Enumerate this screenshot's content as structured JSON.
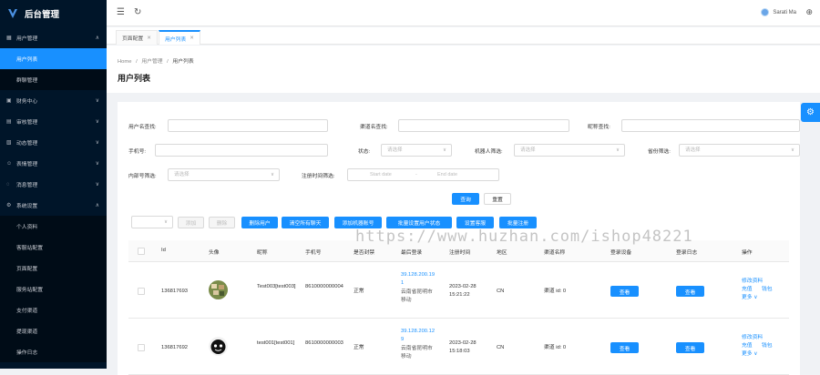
{
  "app": {
    "title": "后台管理"
  },
  "sidebar": {
    "groups": [
      {
        "label": "用户管理",
        "icon": "table-icon",
        "expanded": true,
        "items": [
          {
            "label": "用户列表",
            "active": true
          },
          {
            "label": "群聊管理",
            "active": false
          }
        ]
      },
      {
        "label": "财务中心",
        "icon": "wallet-icon"
      },
      {
        "label": "审核管理",
        "icon": "audit-icon"
      },
      {
        "label": "动态管理",
        "icon": "image-icon"
      },
      {
        "label": "表情管理",
        "icon": "smile-icon"
      },
      {
        "label": "消息管理",
        "icon": "message-icon"
      },
      {
        "label": "系统设置",
        "icon": "gear-icon",
        "expanded": true,
        "items": [
          {
            "label": "个人资料"
          },
          {
            "label": "客服站配置"
          },
          {
            "label": "页面配置"
          },
          {
            "label": "服务站配置"
          },
          {
            "label": "支付渠道"
          },
          {
            "label": "提现渠道"
          },
          {
            "label": "操作日志"
          }
        ]
      }
    ]
  },
  "topbar": {
    "user_name": "Sarati Ma"
  },
  "tabs": [
    {
      "label": "页面配置",
      "active": false
    },
    {
      "label": "用户列表",
      "active": true
    }
  ],
  "breadcrumb": {
    "home": "Home",
    "sep": "/",
    "section": "用户管理",
    "current": "用户列表"
  },
  "page_title": "用户列表",
  "filters": {
    "username_label": "用户名查找:",
    "channel_label": "渠道名查找:",
    "nickname_label": "昵称查找:",
    "phone_label": "手机号:",
    "status_label": "状态:",
    "status_placeholder": "请选择",
    "robot_label": "机器人筛选:",
    "robot_placeholder": "请选择",
    "region_label": "省份筛选:",
    "region_placeholder": "请选择",
    "internal_label": "内部号筛选:",
    "internal_placeholder": "请选择",
    "regtime_label": "注册时间筛选:",
    "start_date": "Start date",
    "date_sep": "-",
    "end_date": "End date",
    "search_button": "查询",
    "reset_button": "重置"
  },
  "actions": {
    "add": "添加",
    "delete": "删除",
    "delete_user": "删除用户",
    "clear_chat": "清空所有聊天",
    "add_robot": "添加机器账号",
    "batch_set": "批量设置用户状态",
    "set_robot": "设置客服",
    "batch_export": "批量注册"
  },
  "table": {
    "columns": [
      "Id",
      "头像",
      "昵称",
      "手机号",
      "是否封禁",
      "最后登录",
      "注册时间",
      "地区",
      "渠道名称",
      "登录设备",
      "登录日志",
      "操作"
    ],
    "rows": [
      {
        "id": "136817693",
        "nickname": "Test003[test003]",
        "phone": "8610000000004",
        "banned": "正常",
        "last_ip": "39.128.200.191",
        "last_loc": "云南省昆明市移动",
        "reg_time": "2023-02-28 15:21:22",
        "region": "CN",
        "channel": "渠道 id: 0",
        "device_btn": "查看",
        "log_btn": "查看",
        "op1": "修改资料",
        "op2": "充值",
        "op3": "钱包",
        "op4": "更多 ∨"
      },
      {
        "id": "136817692",
        "nickname": "test001[test001]",
        "phone": "8610000000003",
        "banned": "正常",
        "last_ip": "39.128.200.129",
        "last_loc": "云南省昆明市移动",
        "reg_time": "2023-02-28 15:18:03",
        "region": "CN",
        "channel": "渠道 id: 0",
        "device_btn": "查看",
        "log_btn": "查看",
        "op1": "修改资料",
        "op2": "充值",
        "op3": "钱包",
        "op4": "更多 ∨"
      }
    ]
  },
  "watermark": "https://www.huzhan.com/ishop48221",
  "colors": {
    "primary": "#1890ff",
    "sidebar_bg": "#001529",
    "active_item": "#1890ff"
  }
}
